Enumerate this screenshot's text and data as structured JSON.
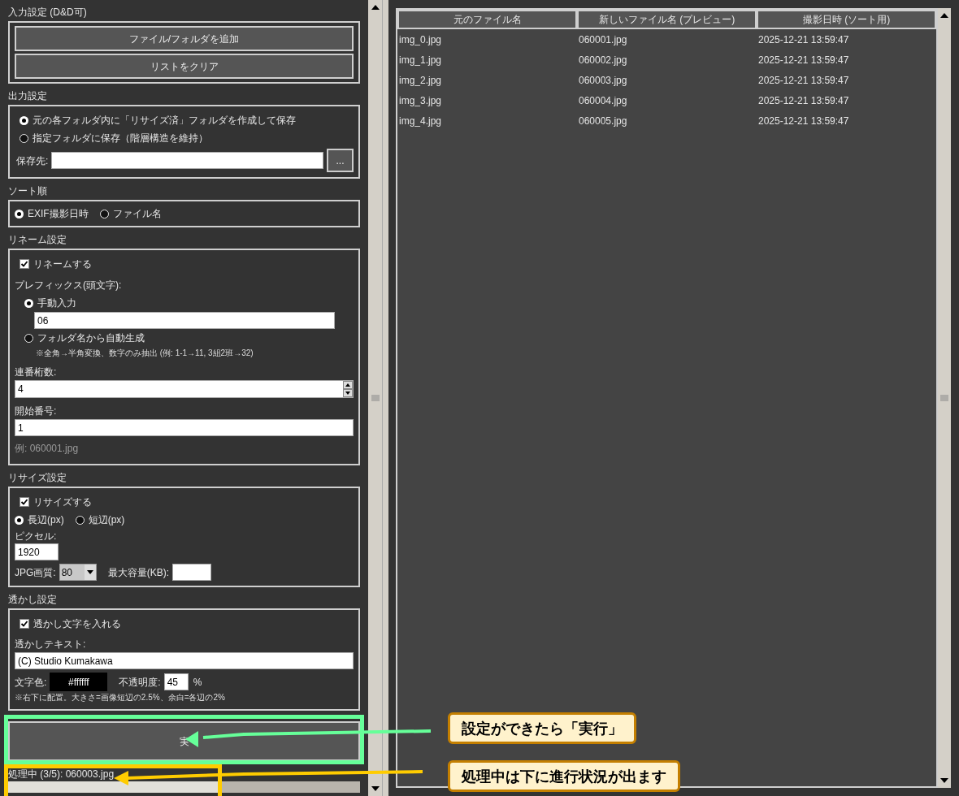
{
  "input_section": {
    "title": "入力設定 (D&D可)",
    "buttons": [
      "ファイル/フォルダを追加",
      "リストをクリア"
    ]
  },
  "output_section": {
    "title": "出力設定",
    "options": [
      {
        "label": "元の各フォルダ内に「リサイズ済」フォルダを作成して保存",
        "selected": true
      },
      {
        "label": "指定フォルダに保存（階層構造を維持）",
        "selected": false
      }
    ],
    "destination": {
      "label": "保存先:",
      "browse_button": "..."
    }
  },
  "sort_section": {
    "title": "ソート順",
    "options": [
      {
        "label": "EXIF撮影日時",
        "selected": true
      },
      {
        "label": "ファイル名",
        "selected": false
      }
    ]
  },
  "rename_section": {
    "title": "リネーム設定",
    "enable": {
      "label": "リネームする",
      "checked": true
    },
    "prefix_label": "プレフィックス(頭文字):",
    "prefix_options": [
      {
        "label": "手動入力",
        "selected": true,
        "value": "06"
      },
      {
        "label": "フォルダ名から自動生成",
        "selected": false,
        "note": "※全角→半角変換、数字のみ抽出 (例: 1-1→11, 3組2班→32)"
      }
    ],
    "digits": {
      "label": "連番桁数:",
      "value": "4"
    },
    "start": {
      "label": "開始番号:",
      "value": "1"
    },
    "example": "例: 060001.jpg"
  },
  "resize_section": {
    "title": "リサイズ設定",
    "enable": {
      "label": "リサイズする",
      "checked": true
    },
    "edge_options": [
      {
        "label": "長辺(px)",
        "selected": true
      },
      {
        "label": "短辺(px)",
        "selected": false
      }
    ],
    "pixels": {
      "label": "ピクセル:",
      "value": "1920"
    },
    "quality": {
      "label": "JPG画質:",
      "value": "80"
    },
    "max_size": {
      "label": "最大容量(KB):"
    }
  },
  "watermark_section": {
    "title": "透かし設定",
    "enable": {
      "label": "透かし文字を入れる",
      "checked": true
    },
    "text": {
      "label": "透かしテキスト:",
      "value": "(C) Studio Kumakawa"
    },
    "color": {
      "label": "文字色:",
      "value": "#ffffff"
    },
    "opacity": {
      "label": "不透明度:",
      "value": "45",
      "unit": "%"
    },
    "note": "※右下に配置。大きさ=画像短辺の2.5%、余白=各辺の2%"
  },
  "run_button": "実",
  "status": "処理中 (3/5): 060003.jpg",
  "progress": {
    "level": 0.6
  },
  "table": {
    "columns": [
      "元のファイル名",
      "新しいファイル名 (プレビュー)",
      "撮影日時 (ソート用)"
    ],
    "rows": [
      [
        "img_0.jpg",
        "060001.jpg",
        "2025-12-21 13:59:47"
      ],
      [
        "img_1.jpg",
        "060002.jpg",
        "2025-12-21 13:59:47"
      ],
      [
        "img_2.jpg",
        "060003.jpg",
        "2025-12-21 13:59:47"
      ],
      [
        "img_3.jpg",
        "060004.jpg",
        "2025-12-21 13:59:47"
      ],
      [
        "img_4.jpg",
        "060005.jpg",
        "2025-12-21 13:59:47"
      ]
    ]
  },
  "annotations": [
    {
      "text": "設定ができたら「実行」",
      "color": "#66ff99"
    },
    {
      "text": "処理中は下に進行状況が出ます",
      "color": "#ffcc00"
    }
  ]
}
